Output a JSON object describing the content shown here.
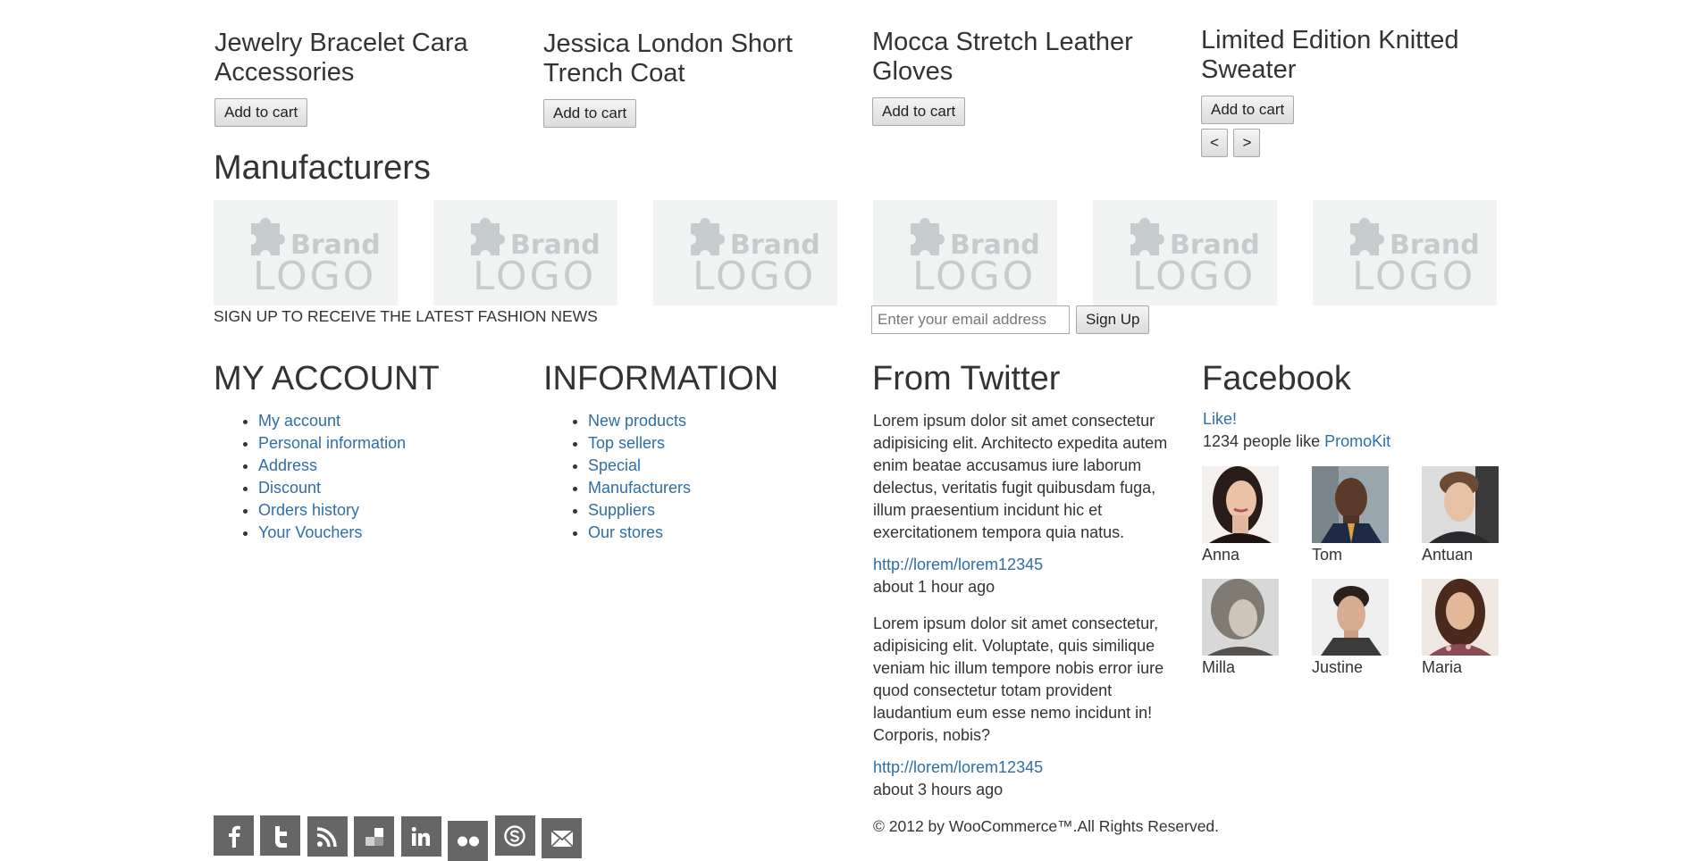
{
  "products": [
    {
      "title": "Jewelry Bracelet Cara Accessories",
      "button": "Add to cart"
    },
    {
      "title": "Jessica London Short Trench Coat",
      "button": "Add to cart"
    },
    {
      "title": "Mocca Stretch Leather Gloves",
      "button": "Add to cart"
    },
    {
      "title": "Limited Edition Knitted Sweater",
      "button": "Add to cart"
    }
  ],
  "carousel": {
    "prev": "<",
    "next": ">"
  },
  "manufacturers": {
    "title": "Manufacturers",
    "logos": [
      {
        "line1": "Brand",
        "line2": "LOGO"
      },
      {
        "line1": "Brand",
        "line2": "LOGO"
      },
      {
        "line1": "Brand",
        "line2": "LOGO"
      },
      {
        "line1": "Brand",
        "line2": "LOGO"
      },
      {
        "line1": "Brand",
        "line2": "LOGO"
      },
      {
        "line1": "Brand",
        "line2": "LOGO"
      }
    ]
  },
  "newsletter": {
    "label": "SIGN UP TO RECEIVE THE LATEST FASHION NEWS",
    "placeholder": "Enter your email address",
    "button": "Sign Up"
  },
  "my_account": {
    "title": "MY ACCOUNT",
    "items": [
      "My account",
      "Personal information",
      "Address",
      "Discount",
      "Orders history",
      "Your Vouchers"
    ]
  },
  "information": {
    "title": "INFORMATION",
    "items": [
      "New products",
      "Top sellers",
      "Special",
      "Manufacturers",
      "Suppliers",
      "Our stores"
    ]
  },
  "twitter": {
    "title": "From Twitter",
    "tweets": [
      {
        "text": "Lorem ipsum dolor sit amet consectetur adipisicing elit. Architecto expedita autem enim beatae accusamus iure laborum delectus, veritatis fugit quibusdam fuga, illum praesentium incidunt hic et exercitationem tempora quia natus.",
        "link": "http://lorem/lorem12345",
        "time": "about 1 hour ago"
      },
      {
        "text": "Lorem ipsum dolor sit amet consectetur, adipisicing elit. Voluptate, quis similique veniam hic illum tempore nobis error iure quod consectetur totam provident laudantium eum esse nemo incidunt in! Corporis, nobis?",
        "link": "http://lorem/lorem12345",
        "time": "about 3 hours ago"
      }
    ]
  },
  "facebook": {
    "title": "Facebook",
    "like": "Like!",
    "people_text": "1234 people like",
    "page_name": "PromoKit",
    "people": [
      "Anna",
      "Tom",
      "Antuan",
      "Milla",
      "Justine",
      "Maria"
    ]
  },
  "social": [
    {
      "name": "facebook-icon",
      "glyph": "f"
    },
    {
      "name": "twitter-icon",
      "glyph": "t"
    },
    {
      "name": "rss-icon",
      "glyph": ""
    },
    {
      "name": "delicious-icon",
      "glyph": ""
    },
    {
      "name": "linkedin-icon",
      "glyph": "in"
    },
    {
      "name": "flickr-icon",
      "glyph": "••"
    },
    {
      "name": "skype-icon",
      "glyph": "S"
    },
    {
      "name": "email-icon",
      "glyph": "✉"
    }
  ],
  "footer": {
    "copyright": "© 2012 by WooCommerce™.All Rights Reserved."
  },
  "colors": {
    "link": "#2f6ea6",
    "social_bg": "#666666",
    "logo_bg": "#f1f2f2",
    "logo_fg": "#c6cccd"
  }
}
